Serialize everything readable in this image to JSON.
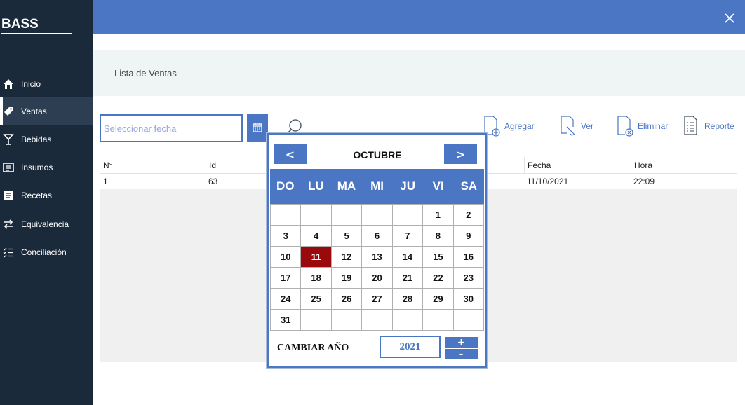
{
  "sidebar": {
    "brand": "BASS",
    "items": [
      {
        "label": "Inicio",
        "icon": "home-icon"
      },
      {
        "label": "Ventas",
        "icon": "tag-icon",
        "active": true
      },
      {
        "label": "Bebidas",
        "icon": "glass-icon"
      },
      {
        "label": "Insumos",
        "icon": "list-box-icon"
      },
      {
        "label": "Recetas",
        "icon": "recipe-icon"
      },
      {
        "label": "Equivalencia",
        "icon": "swap-icon"
      },
      {
        "label": "Conciliación",
        "icon": "checklist-icon"
      }
    ]
  },
  "header": {
    "close_icon": "close-icon"
  },
  "page": {
    "title": "Lista de Ventas"
  },
  "toolbar": {
    "date_placeholder": "Seleccionar fecha",
    "date_value": "",
    "actions": {
      "add": "Agregar",
      "view": "Ver",
      "delete": "Eliminar",
      "report": "Reporte"
    }
  },
  "table": {
    "columns": [
      "N°",
      "Id",
      "Fecha",
      "Hora"
    ],
    "rows": [
      {
        "n": "1",
        "id": "63",
        "fecha": "11/10/2021",
        "hora": "22:09"
      }
    ]
  },
  "calendar": {
    "prev_label": "<",
    "next_label": ">",
    "month": "OCTUBRE",
    "day_names": [
      "DO",
      "LU",
      "MA",
      "MI",
      "JU",
      "VI",
      "SA"
    ],
    "first_weekday": 5,
    "days_in_month": 31,
    "selected_day": 11,
    "year_label": "CAMBIAR AÑO",
    "year": "2021",
    "plus_label": "+",
    "minus_label": "-"
  },
  "colors": {
    "accent": "#4a76c4",
    "sidebar": "#1b2a3a",
    "selected_day": "#9b0a0a"
  }
}
